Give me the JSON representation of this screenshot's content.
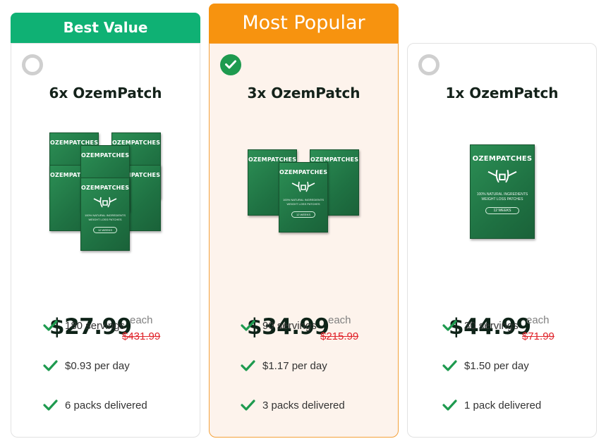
{
  "plans": [
    {
      "ribbon": "Best Value",
      "title": "6x OzemPatch",
      "selected": false,
      "price": "$27.99",
      "each": "each",
      "original_price": "$431.99",
      "features": [
        "180 servings",
        "$0.93 per day",
        "6 packs delivered"
      ]
    },
    {
      "ribbon": "Most Popular",
      "title": "3x OzemPatch",
      "selected": true,
      "price": "$34.99",
      "each": "each",
      "original_price": "$215.99",
      "features": [
        "90 servings",
        "$1.17 per day",
        "3 packs delivered"
      ]
    },
    {
      "ribbon": "",
      "title": "1x OzemPatch",
      "selected": false,
      "price": "$44.99",
      "each": "each",
      "original_price": "$71.99",
      "features": [
        "30 servings",
        "$1.50 per day",
        "1 pack delivered"
      ]
    }
  ],
  "product_box": {
    "brand": "OZEMPATCHES",
    "line1": "100% NATURAL INGREDIENTS",
    "line2": "WEIGHT LOSS PATCHES",
    "duration": "12 WEEKS"
  },
  "icons": {
    "check": "check-icon",
    "radio_selected": "checkmark-circle-icon",
    "radio_unselected": "empty-radio-icon"
  },
  "colors": {
    "best_value_ribbon": "#0fb174",
    "most_popular_ribbon": "#f7930f",
    "popular_card_bg": "#fdf3ec",
    "check_green": "#1e9a4f",
    "old_price_red": "#e0242b",
    "price_text": "#0e2318"
  }
}
